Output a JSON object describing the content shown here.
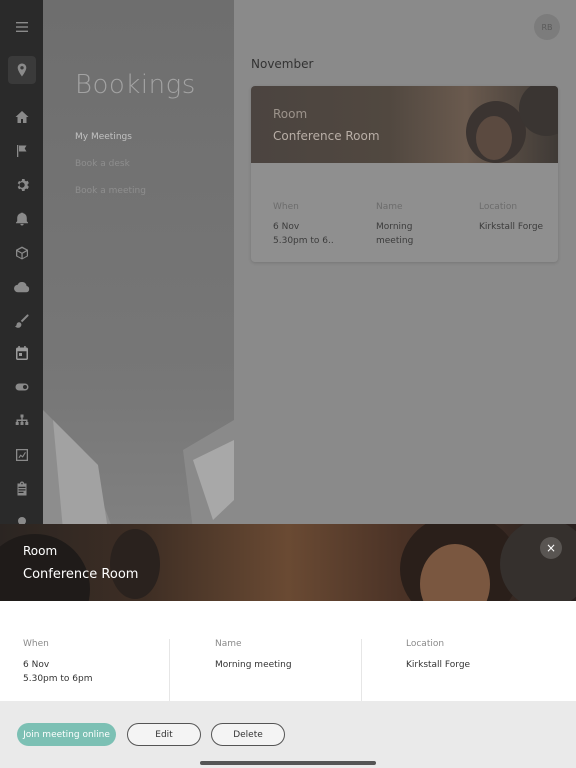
{
  "sidebar": {
    "icons": [
      "menu-icon",
      "location-pin-icon",
      "home-icon",
      "flag-icon",
      "gear-icon",
      "bell-icon",
      "cube-icon",
      "cloud-icon",
      "brush-icon",
      "calendar-icon",
      "toggle-icon",
      "hierarchy-icon",
      "chart-icon",
      "clipboard-icon",
      "settings-icon"
    ]
  },
  "nav": {
    "title": "Bookings",
    "links": [
      {
        "label": "My Meetings",
        "active": true
      },
      {
        "label": "Book a desk",
        "active": false
      },
      {
        "label": "Book a meeting",
        "active": false
      }
    ]
  },
  "header": {
    "avatar_initials": "RB"
  },
  "main": {
    "month": "November",
    "card": {
      "type": "Room",
      "name": "Conference Room",
      "when_label": "When",
      "when_date": "6 Nov",
      "when_time": "5.30pm to 6..",
      "name_label": "Name",
      "name_value_line1": "Morning",
      "name_value_line2": "meeting",
      "location_label": "Location",
      "location_value": "Kirkstall Forge"
    }
  },
  "sheet": {
    "type": "Room",
    "name": "Conference Room",
    "close_icon": "×",
    "when_label": "When",
    "when_date": "6 Nov",
    "when_time": "5.30pm to 6pm",
    "name_label": "Name",
    "name_value": "Morning meeting",
    "location_label": "Location",
    "location_value": "Kirkstall Forge"
  },
  "actions": {
    "join_label": "Join meeting online",
    "edit_label": "Edit",
    "delete_label": "Delete"
  },
  "colors": {
    "accent": "#7cc0b4"
  }
}
